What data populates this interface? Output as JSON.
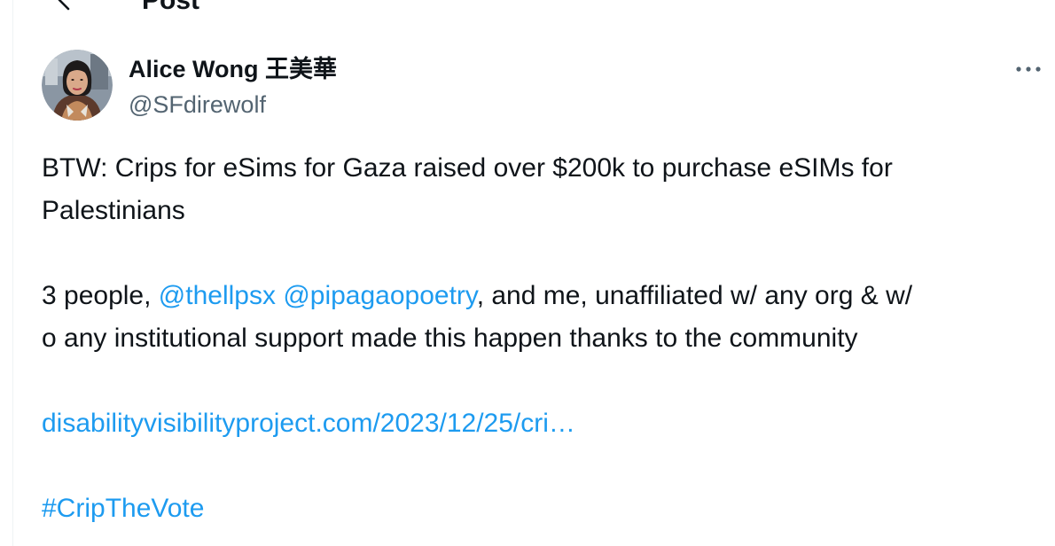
{
  "header": {
    "back_icon": "arrow-left-icon",
    "title": "Post"
  },
  "author": {
    "display_name": "Alice Wong 王美華",
    "handle": "@SFdirewolf",
    "avatar_icon": "avatar-photo"
  },
  "more_icon": "more-horizontal-icon",
  "post": {
    "line1": "BTW: Crips for eSims for Gaza raised over $200k to purchase eSIMs for",
    "line2": "Palestinians",
    "line3_prefix": "3 people, ",
    "mention1": "@thellpsx",
    "mention_space": " ",
    "mention2": "@pipagaopoetry",
    "line3_suffix": ", and me, unaffiliated w/ any org & w/",
    "line4": "o any institutional support made this happen thanks to the community",
    "link": "disabilityvisibilityproject.com/2023/12/25/cri…",
    "hashtag": "#CripTheVote"
  },
  "colors": {
    "text": "#0f1419",
    "secondary": "#536471",
    "link": "#1d9bf0",
    "border": "#eff3f4"
  }
}
